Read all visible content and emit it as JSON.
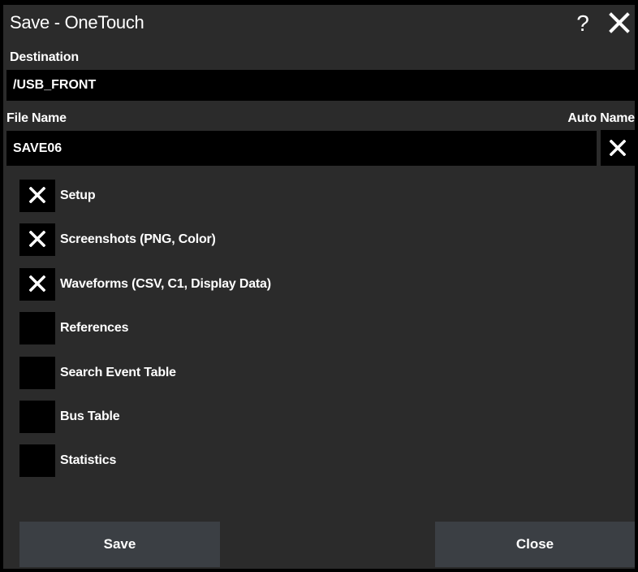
{
  "dialog": {
    "title": "Save - OneTouch",
    "help_label": "?"
  },
  "destination": {
    "label": "Destination",
    "value": "/USB_FRONT"
  },
  "file_name": {
    "label": "File Name",
    "value": "SAVE06",
    "auto_name_label": "Auto Name",
    "auto_name_checked": true
  },
  "options": [
    {
      "label": "Setup",
      "checked": true
    },
    {
      "label": "Screenshots (PNG, Color)",
      "checked": true
    },
    {
      "label": "Waveforms (CSV, C1, Display Data)",
      "checked": true
    },
    {
      "label": "References",
      "checked": false
    },
    {
      "label": "Search Event Table",
      "checked": false
    },
    {
      "label": "Bus Table",
      "checked": false
    },
    {
      "label": "Statistics",
      "checked": false
    }
  ],
  "buttons": {
    "save": "Save",
    "close": "Close"
  },
  "colors": {
    "background": "#2b2b2b",
    "field": "#000000",
    "button": "#3b3f44",
    "text": "#ffffff"
  }
}
